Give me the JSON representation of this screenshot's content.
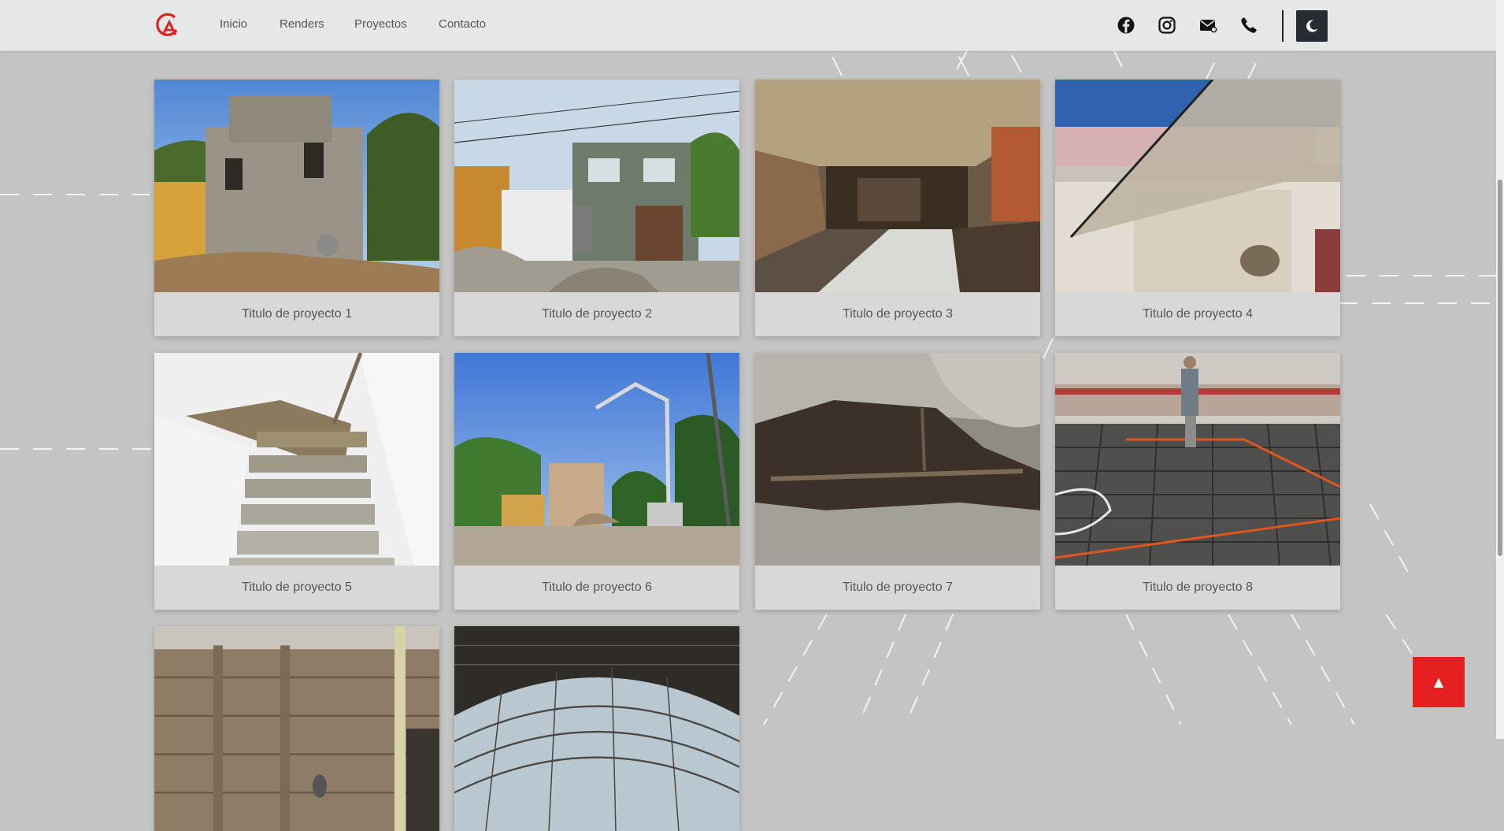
{
  "nav": {
    "links": [
      "Inicio",
      "Renders",
      "Proyectos",
      "Contacto"
    ]
  },
  "colors": {
    "accent": "#e42021",
    "navbar": "#e6e7e7",
    "page_bg": "#c4c4c4",
    "theme_button": "#252d33"
  },
  "icons": {
    "logo": "ga-logo-icon",
    "social": [
      "facebook-icon",
      "instagram-icon",
      "mail-icon",
      "phone-icon"
    ],
    "theme": "moon-icon",
    "back_to_top": "arrow-up-icon"
  },
  "projects": [
    {
      "title": "Titulo de proyecto 1"
    },
    {
      "title": "Titulo de proyecto 2"
    },
    {
      "title": "Titulo de proyecto 3"
    },
    {
      "title": "Titulo de proyecto 4"
    },
    {
      "title": "Titulo de proyecto 5"
    },
    {
      "title": "Titulo de proyecto 6"
    },
    {
      "title": "Titulo de proyecto 7"
    },
    {
      "title": "Titulo de proyecto 8"
    }
  ],
  "back_to_top": {
    "label": "▲"
  }
}
